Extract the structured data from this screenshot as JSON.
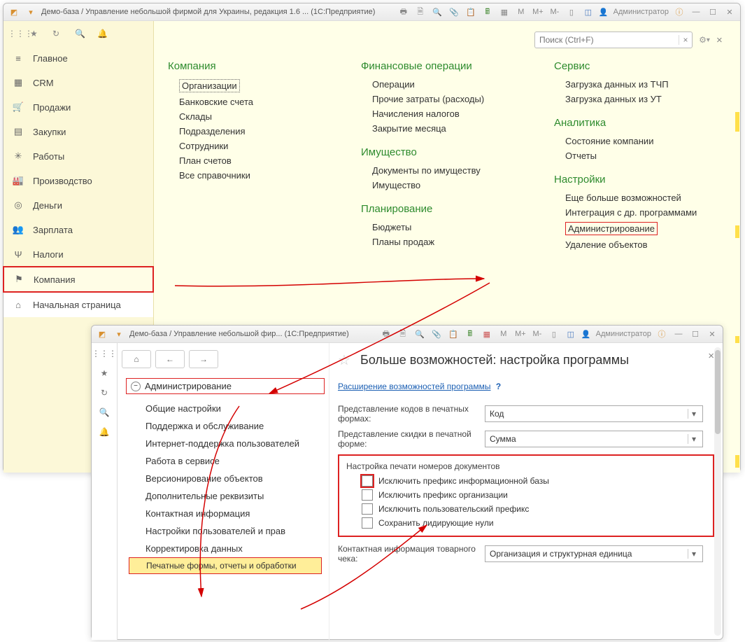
{
  "win1": {
    "title": "Демо-база / Управление небольшой фирмой для Украины, редакция 1.6 ...   (1С:Предприятие)",
    "admin": "Администратор",
    "tb_m": "M",
    "tb_mplus": "M+",
    "tb_mminus": "M-",
    "search_ph": "Поиск (Ctrl+F)",
    "sidebar": [
      {
        "icon": "≡",
        "label": "Главное"
      },
      {
        "icon": "▦",
        "label": "CRM"
      },
      {
        "icon": "🛒",
        "label": "Продажи"
      },
      {
        "icon": "▤",
        "label": "Закупки"
      },
      {
        "icon": "✳",
        "label": "Работы"
      },
      {
        "icon": "🏭",
        "label": "Производство"
      },
      {
        "icon": "◎",
        "label": "Деньги"
      },
      {
        "icon": "👥",
        "label": "Зарплата"
      },
      {
        "icon": "Ψ",
        "label": "Налоги"
      },
      {
        "icon": "⚑",
        "label": "Компания"
      }
    ],
    "home": "Начальная страница",
    "col1": {
      "g1": "Компания",
      "i1": [
        "Организации",
        "Банковские счета",
        "Склады",
        "Подразделения",
        "Сотрудники",
        "План счетов",
        "Все справочники"
      ]
    },
    "col2": {
      "g1": "Финансовые операции",
      "i1": [
        "Операции",
        "Прочие затраты (расходы)",
        "Начисления налогов",
        "Закрытие месяца"
      ],
      "g2": "Имущество",
      "i2": [
        "Документы по имуществу",
        "Имущество"
      ],
      "g3": "Планирование",
      "i3": [
        "Бюджеты",
        "Планы продаж"
      ]
    },
    "col3": {
      "g1": "Сервис",
      "i1": [
        "Загрузка данных из ТЧП",
        "Загрузка данных из УТ"
      ],
      "g2": "Аналитика",
      "i2": [
        "Состояние компании",
        "Отчеты"
      ],
      "g3": "Настройки",
      "i3": [
        "Еще больше возможностей",
        "Интеграция с др. программами",
        "Администрирование",
        "Удаление объектов"
      ]
    }
  },
  "win2": {
    "title": "Демо-база / Управление небольшой фир...   (1С:Предприятие)",
    "admin": "Администратор",
    "tb_m": "M",
    "tb_mplus": "M+",
    "tb_mminus": "M-",
    "page_title": "Больше возможностей: настройка программы",
    "tree_root": "Администрирование",
    "tree": [
      "Общие настройки",
      "Поддержка и обслуживание",
      "Интернет-поддержка пользователей",
      "Работа в сервисе",
      "Версионирование объектов",
      "Дополнительные реквизиты",
      "Контактная информация",
      "Настройки пользователей и прав",
      "Корректировка данных",
      "Печатные формы, отчеты и обработки"
    ],
    "link_expand": "Расширение возможностей программы",
    "row1_label": "Представление кодов в печатных формах:",
    "row1_val": "Код",
    "row2_label": "Представление скидки в печатной форме:",
    "row2_val": "Сумма",
    "grp_title": "Настройка печати номеров документов",
    "chk1": "Исключить префикс информационной базы",
    "chk2": "Исключить префикс организации",
    "chk3": "Исключить пользовательский префикс",
    "chk4": "Сохранить лидирующие нули",
    "row3_label": "Контактная информация товарного чека:",
    "row3_val": "Организация и структурная единица"
  }
}
